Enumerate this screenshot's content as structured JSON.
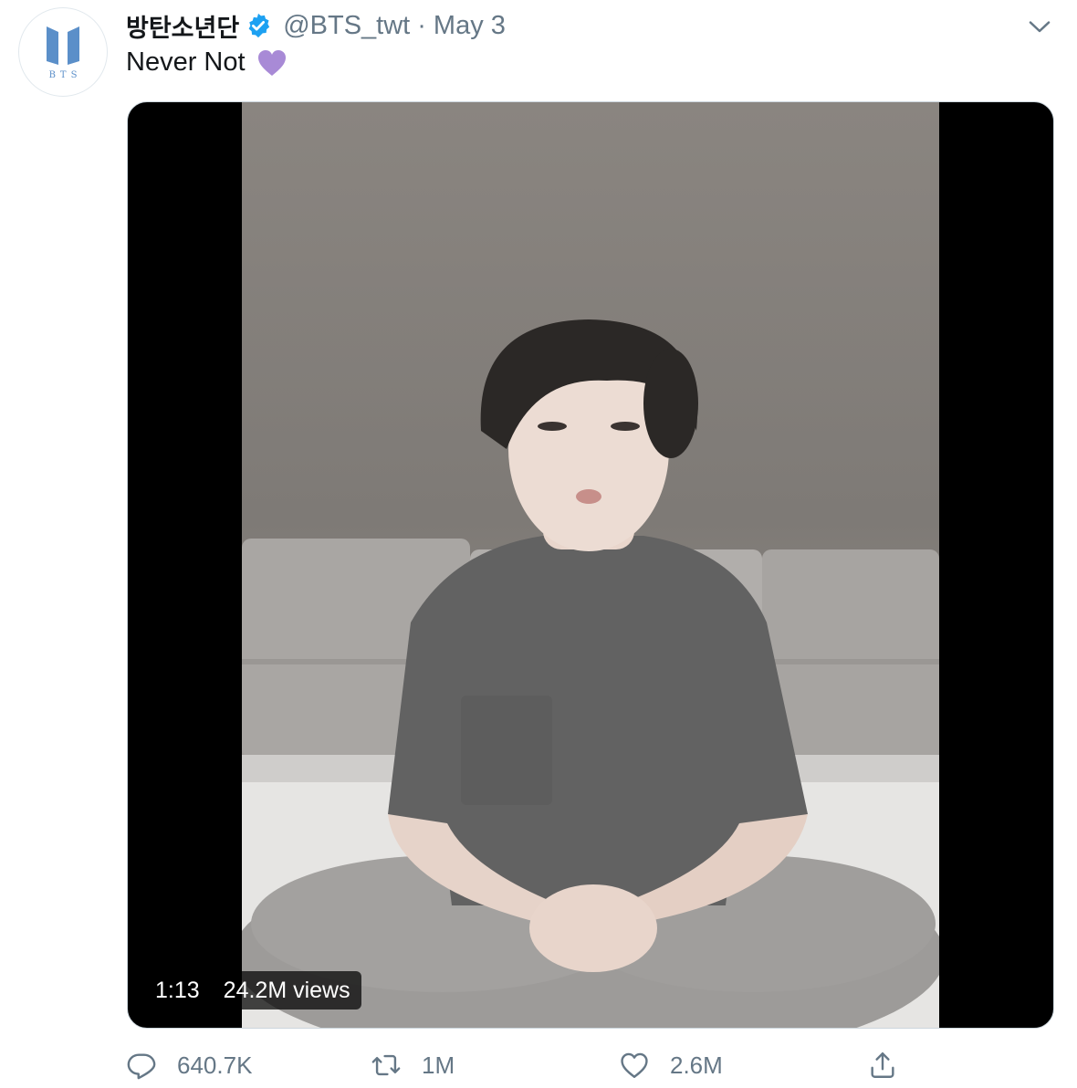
{
  "author": {
    "display_name": "방탄소년단",
    "handle": "@BTS_twt",
    "separator": "·",
    "date": "May 3",
    "avatar_text": "BTS",
    "verified": true
  },
  "tweet": {
    "text": "Never Not",
    "emoji": "purple-heart"
  },
  "video": {
    "duration": "1:13",
    "views": "24.2M views"
  },
  "actions": {
    "reply_count": "640.7K",
    "retweet_count": "1M",
    "like_count": "2.6M"
  },
  "colors": {
    "accent": "#1da1f2",
    "secondary_text": "#657786",
    "heart": "#a88ad6"
  }
}
